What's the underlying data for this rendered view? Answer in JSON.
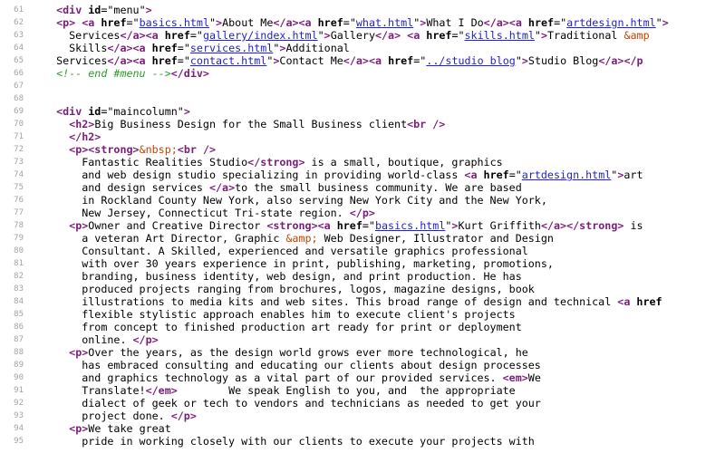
{
  "editor": {
    "lines": [
      {
        "n": "61",
        "tokens": [
          [
            "tx",
            "  "
          ],
          [
            "t",
            "<div "
          ],
          [
            "a",
            "id"
          ],
          [
            "q",
            "=\""
          ],
          [
            "tx",
            "menu"
          ],
          [
            "q",
            "\""
          ],
          [
            "t",
            ">"
          ]
        ]
      },
      {
        "n": "62",
        "tokens": [
          [
            "tx",
            "  "
          ],
          [
            "t",
            "<p> <a "
          ],
          [
            "a",
            "href"
          ],
          [
            "q",
            "=\""
          ],
          [
            "s",
            "basics.html"
          ],
          [
            "q",
            "\""
          ],
          [
            "t",
            ">"
          ],
          [
            "tx",
            "About Me"
          ],
          [
            "t",
            "</a><a "
          ],
          [
            "a",
            "href"
          ],
          [
            "q",
            "=\""
          ],
          [
            "s",
            "what.html"
          ],
          [
            "q",
            "\""
          ],
          [
            "t",
            ">"
          ],
          [
            "tx",
            "What I Do"
          ],
          [
            "t",
            "</a><a "
          ],
          [
            "a",
            "href"
          ],
          [
            "q",
            "=\""
          ],
          [
            "s",
            "artdesign.html"
          ],
          [
            "q",
            "\""
          ],
          [
            "t",
            ">"
          ]
        ]
      },
      {
        "n": "63",
        "tokens": [
          [
            "tx",
            "    Services"
          ],
          [
            "t",
            "</a><a "
          ],
          [
            "a",
            "href"
          ],
          [
            "q",
            "=\""
          ],
          [
            "s",
            "gallery/index.html"
          ],
          [
            "q",
            "\""
          ],
          [
            "t",
            ">"
          ],
          [
            "tx",
            "Gallery"
          ],
          [
            "t",
            "</a> <a "
          ],
          [
            "a",
            "href"
          ],
          [
            "q",
            "=\""
          ],
          [
            "s",
            "skills.html"
          ],
          [
            "q",
            "\""
          ],
          [
            "t",
            ">"
          ],
          [
            "tx",
            "Traditional "
          ],
          [
            "e",
            "&amp"
          ]
        ]
      },
      {
        "n": "64",
        "tokens": [
          [
            "tx",
            "    Skills"
          ],
          [
            "t",
            "</a><a "
          ],
          [
            "a",
            "href"
          ],
          [
            "q",
            "=\""
          ],
          [
            "s",
            "services.html"
          ],
          [
            "q",
            "\""
          ],
          [
            "t",
            ">"
          ],
          [
            "tx",
            "Additional"
          ]
        ]
      },
      {
        "n": "65",
        "tokens": [
          [
            "tx",
            "  Services"
          ],
          [
            "t",
            "</a><a "
          ],
          [
            "a",
            "href"
          ],
          [
            "q",
            "=\""
          ],
          [
            "s",
            "contact.html"
          ],
          [
            "q",
            "\""
          ],
          [
            "t",
            ">"
          ],
          [
            "tx",
            "Contact Me"
          ],
          [
            "t",
            "</a><a "
          ],
          [
            "a",
            "href"
          ],
          [
            "q",
            "=\""
          ],
          [
            "s",
            "../studio blog"
          ],
          [
            "q",
            "\""
          ],
          [
            "t",
            ">"
          ],
          [
            "tx",
            "Studio Blog"
          ],
          [
            "t",
            "</a></p"
          ]
        ]
      },
      {
        "n": "66",
        "tokens": [
          [
            "c",
            "  <!-- end #menu -->"
          ],
          [
            "t",
            "</div>"
          ]
        ]
      },
      {
        "n": "67",
        "tokens": []
      },
      {
        "n": "68",
        "tokens": []
      },
      {
        "n": "69",
        "tokens": [
          [
            "tx",
            "  "
          ],
          [
            "t",
            "<div "
          ],
          [
            "a",
            "id"
          ],
          [
            "q",
            "=\""
          ],
          [
            "tx",
            "maincolumn"
          ],
          [
            "q",
            "\""
          ],
          [
            "t",
            ">"
          ]
        ]
      },
      {
        "n": "70",
        "tokens": [
          [
            "tx",
            "    "
          ],
          [
            "t",
            "<h2>"
          ],
          [
            "tx",
            "Big Business Design for the Small Business client"
          ],
          [
            "t",
            "<br />"
          ]
        ]
      },
      {
        "n": "71",
        "tokens": [
          [
            "tx",
            "    "
          ],
          [
            "t",
            "</h2>"
          ]
        ]
      },
      {
        "n": "72",
        "tokens": [
          [
            "tx",
            "    "
          ],
          [
            "t",
            "<p><strong>"
          ],
          [
            "e",
            "&nbsp;"
          ],
          [
            "t",
            "<br />"
          ]
        ]
      },
      {
        "n": "73",
        "tokens": [
          [
            "tx",
            "      Fantastic Realities Studio"
          ],
          [
            "t",
            "</strong>"
          ],
          [
            "tx",
            " is a small, boutique, graphics"
          ]
        ]
      },
      {
        "n": "74",
        "tokens": [
          [
            "tx",
            "      and web design studio specializing in providing world-class "
          ],
          [
            "t",
            "<a "
          ],
          [
            "a",
            "href"
          ],
          [
            "q",
            "=\""
          ],
          [
            "s",
            "artdesign.html"
          ],
          [
            "q",
            "\""
          ],
          [
            "t",
            ">"
          ],
          [
            "tx",
            "art"
          ]
        ]
      },
      {
        "n": "75",
        "tokens": [
          [
            "tx",
            "      and design services "
          ],
          [
            "t",
            "</a>"
          ],
          [
            "tx",
            "to the small business community. We are based"
          ]
        ]
      },
      {
        "n": "76",
        "tokens": [
          [
            "tx",
            "      in Rockland County New York, also serving New York City and the New York,"
          ]
        ]
      },
      {
        "n": "77",
        "tokens": [
          [
            "tx",
            "      New Jersey, Connecticut Tri-state region. "
          ],
          [
            "t",
            "</p>"
          ]
        ]
      },
      {
        "n": "78",
        "tokens": [
          [
            "tx",
            "    "
          ],
          [
            "t",
            "<p>"
          ],
          [
            "tx",
            "Owner and Creative Director "
          ],
          [
            "t",
            "<strong><a "
          ],
          [
            "a",
            "href"
          ],
          [
            "q",
            "=\""
          ],
          [
            "s",
            "basics.html"
          ],
          [
            "q",
            "\""
          ],
          [
            "t",
            ">"
          ],
          [
            "tx",
            "Kurt Griffith"
          ],
          [
            "t",
            "</a></strong>"
          ],
          [
            "tx",
            " is"
          ]
        ]
      },
      {
        "n": "79",
        "tokens": [
          [
            "tx",
            "      a veteran Art Director, Graphic "
          ],
          [
            "e",
            "&amp;"
          ],
          [
            "tx",
            " Web Designer, Illustrator and Design"
          ]
        ]
      },
      {
        "n": "80",
        "tokens": [
          [
            "tx",
            "      Consultant. A Skilled, experienced and versatile graphics professional"
          ]
        ]
      },
      {
        "n": "81",
        "tokens": [
          [
            "tx",
            "      with over 30 years experience in print, publishing, marketing, promotions,"
          ]
        ]
      },
      {
        "n": "82",
        "tokens": [
          [
            "tx",
            "      branding, business identity, web design, and print production. He has"
          ]
        ]
      },
      {
        "n": "83",
        "tokens": [
          [
            "tx",
            "      produced projects ranging from brochures, logos, magazine designs, book"
          ]
        ]
      },
      {
        "n": "84",
        "tokens": [
          [
            "tx",
            "      illustrations to media kits and web sites. This broad range of design and technical "
          ],
          [
            "t",
            "<a "
          ],
          [
            "a",
            "href"
          ]
        ]
      },
      {
        "n": "85",
        "tokens": [
          [
            "tx",
            "      flexible stylistic approach enables him to execute client's projects"
          ]
        ]
      },
      {
        "n": "86",
        "tokens": [
          [
            "tx",
            "      from concept to finished production art ready for print or deployment"
          ]
        ]
      },
      {
        "n": "87",
        "tokens": [
          [
            "tx",
            "      online. "
          ],
          [
            "t",
            "</p>"
          ]
        ]
      },
      {
        "n": "88",
        "tokens": [
          [
            "tx",
            "    "
          ],
          [
            "t",
            "<p>"
          ],
          [
            "tx",
            "Over the years, as the design world grows ever more technological, he"
          ]
        ]
      },
      {
        "n": "89",
        "tokens": [
          [
            "tx",
            "      has embraced consulting and educating our clients about design processes"
          ]
        ]
      },
      {
        "n": "90",
        "tokens": [
          [
            "tx",
            "      and graphics technology as a vital part of our provided services. "
          ],
          [
            "t",
            "<em>"
          ],
          [
            "tx",
            "We"
          ]
        ]
      },
      {
        "n": "91",
        "tokens": [
          [
            "tx",
            "      Translate!"
          ],
          [
            "t",
            "</em>"
          ],
          [
            "tx",
            "        We speak English to you, and  the appropriate"
          ]
        ]
      },
      {
        "n": "92",
        "tokens": [
          [
            "tx",
            "      dialect of geek or tech to vendors and technicians as needed to get your"
          ]
        ]
      },
      {
        "n": "93",
        "tokens": [
          [
            "tx",
            "      project done. "
          ],
          [
            "t",
            "</p>"
          ]
        ]
      },
      {
        "n": "94",
        "tokens": [
          [
            "tx",
            "    "
          ],
          [
            "t",
            "<p>"
          ],
          [
            "tx",
            "We take great"
          ]
        ]
      },
      {
        "n": "95",
        "tokens": [
          [
            "tx",
            "      pride in working closely with our clients to execute your projects with"
          ]
        ]
      }
    ]
  }
}
